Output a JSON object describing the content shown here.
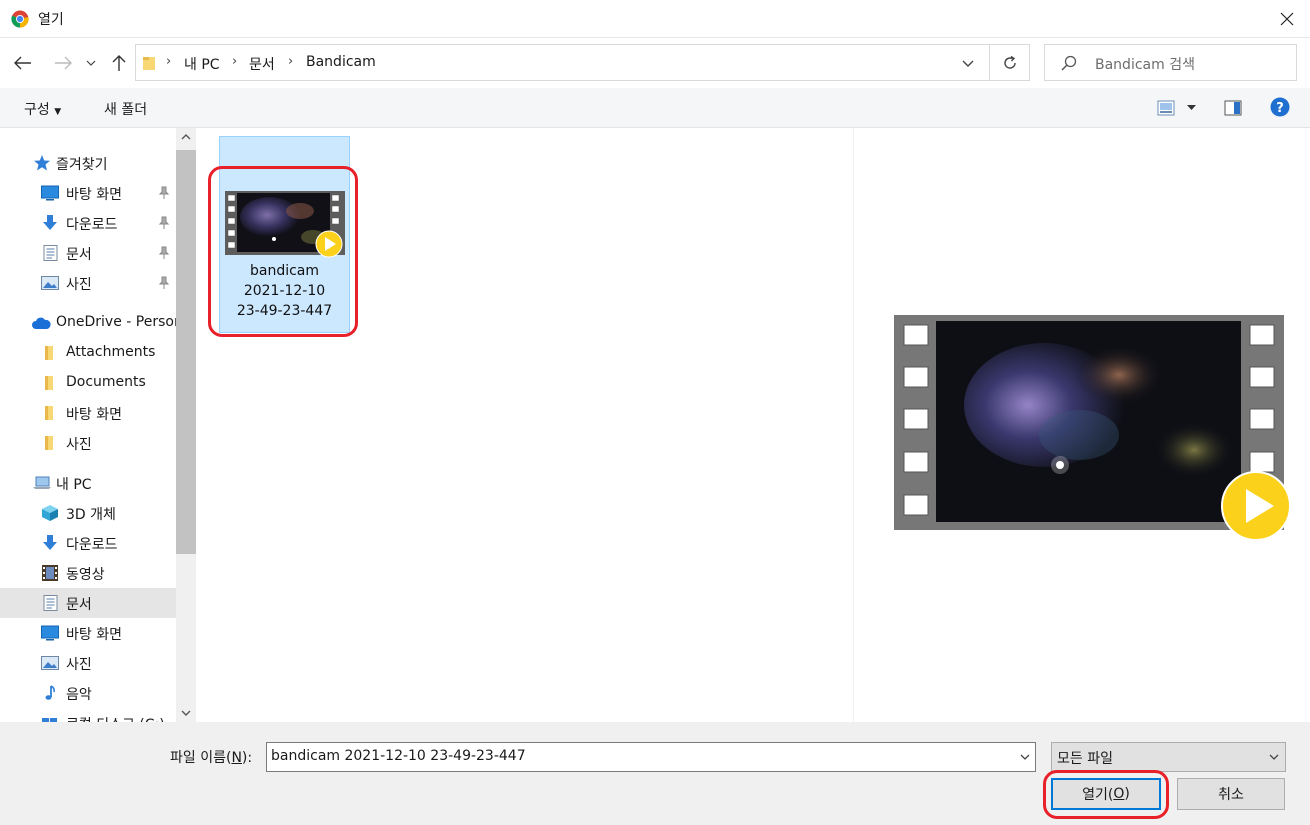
{
  "window": {
    "title": "열기"
  },
  "address": {
    "crumbs": [
      "내 PC",
      "문서",
      "Bandicam"
    ],
    "search_placeholder": "Bandicam 검색"
  },
  "toolbar": {
    "organize": "구성",
    "new_folder": "새 폴더"
  },
  "sidebar": {
    "items": [
      {
        "label": "즐겨찾기",
        "icon": "star-icon"
      },
      {
        "label": "바탕 화면",
        "icon": "desktop-icon",
        "pinned": true
      },
      {
        "label": "다운로드",
        "icon": "download-icon",
        "pinned": true
      },
      {
        "label": "문서",
        "icon": "document-icon",
        "pinned": true
      },
      {
        "label": "사진",
        "icon": "picture-icon",
        "pinned": true
      },
      {
        "label": "OneDrive - Personal",
        "icon": "cloud-icon"
      },
      {
        "label": "Attachments",
        "icon": "folder-icon"
      },
      {
        "label": "Documents",
        "icon": "folder-icon"
      },
      {
        "label": "바탕 화면",
        "icon": "folder-icon"
      },
      {
        "label": "사진",
        "icon": "folder-icon"
      },
      {
        "label": "내 PC",
        "icon": "pc-icon"
      },
      {
        "label": "3D 개체",
        "icon": "cube-icon"
      },
      {
        "label": "다운로드",
        "icon": "download-icon"
      },
      {
        "label": "동영상",
        "icon": "film-icon"
      },
      {
        "label": "문서",
        "icon": "document-icon",
        "selected": true
      },
      {
        "label": "바탕 화면",
        "icon": "desktop-icon"
      },
      {
        "label": "사진",
        "icon": "picture-icon"
      },
      {
        "label": "음악",
        "icon": "music-icon"
      },
      {
        "label": "로컬 디스크 (C:)",
        "icon": "drive-icon"
      }
    ]
  },
  "files": [
    {
      "name_lines": [
        "bandicam",
        "2021-12-10",
        "23-49-23-447"
      ]
    }
  ],
  "footer": {
    "filename_label": "파일 이름(",
    "filename_mnemonic": "N",
    "filename_label_end": "):",
    "filename_value": "bandicam 2021-12-10 23-49-23-447",
    "filetype_value": "모든 파일",
    "open_label": "열기(",
    "open_mnemonic": "O",
    "open_label_end": ")",
    "cancel_label": "취소"
  }
}
